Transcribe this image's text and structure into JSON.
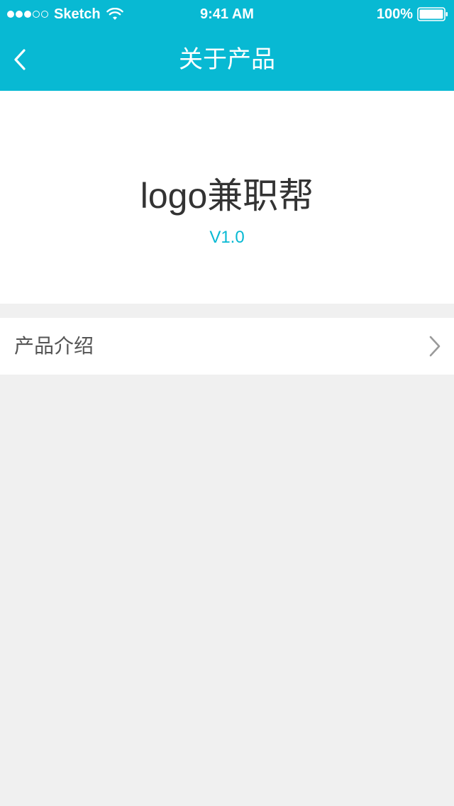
{
  "status_bar": {
    "carrier": "Sketch",
    "time": "9:41 AM",
    "battery_percent": "100%",
    "signal_strength": 3,
    "signal_max": 5,
    "background_color": "#08b9d3"
  },
  "nav_bar": {
    "title": "关于产品",
    "back_icon": "chevron-left-icon"
  },
  "product": {
    "name": "logo兼职帮",
    "version": "V1.0"
  },
  "menu": {
    "items": [
      {
        "label": "产品介绍",
        "icon": "chevron-right-icon"
      }
    ]
  },
  "colors": {
    "accent": "#08b9d3",
    "background": "#f0f0f0",
    "card": "#ffffff",
    "text_primary": "#333333",
    "text_secondary": "#555555"
  }
}
